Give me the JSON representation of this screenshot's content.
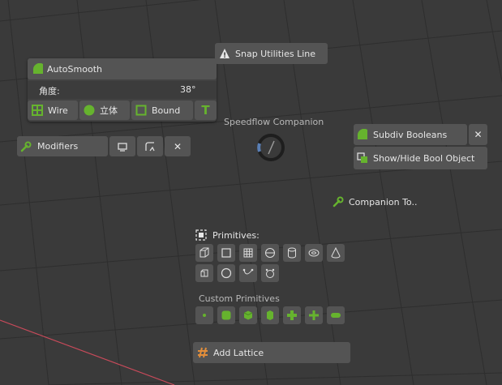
{
  "autosmooth": {
    "title": "AutoSmooth",
    "angle_label": "角度:",
    "angle_value": "38°",
    "wire": "Wire",
    "solid": "立体",
    "bound": "Bound",
    "text_icon": "T"
  },
  "modifiers": {
    "label": "Modifiers",
    "close": "✕"
  },
  "snap_utilities": {
    "label": "Snap Utilities Line",
    "warning": "!"
  },
  "speedflow": {
    "label": "Speedflow Companion"
  },
  "subdiv": {
    "label": "Subdiv Booleans",
    "close": "✕",
    "showhide": "Show/Hide Bool Object"
  },
  "companion_tools": {
    "label": "Companion To.."
  },
  "primitives": {
    "label": "Primitives:"
  },
  "custom_primitives": {
    "label": "Custom Primitives"
  },
  "add_lattice": {
    "label": "Add Lattice"
  },
  "colors": {
    "accent_green": "#66b32e",
    "lattice_orange": "#e38e3a",
    "bg": "#3a3a3a",
    "button": "#545454",
    "axis_red": "#c84a5a"
  }
}
